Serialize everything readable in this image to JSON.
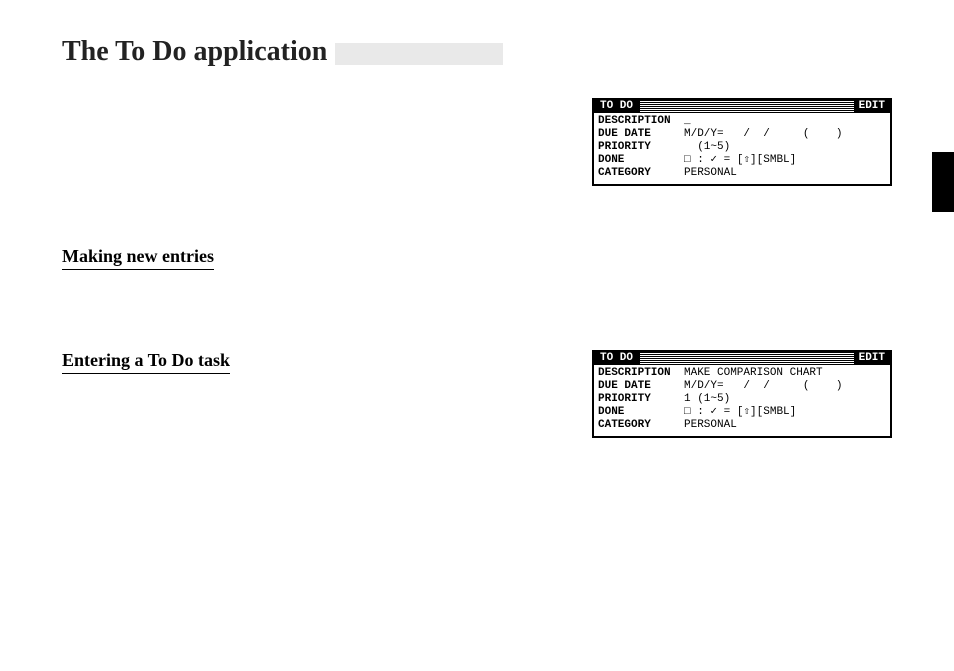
{
  "heading": "The To Do application",
  "section1_title": "Making new entries",
  "section2_title": "Entering a To Do task",
  "lcd1": {
    "tab": "TO DO",
    "mode": "EDIT",
    "rows": {
      "desc_label": "DESCRIPTION",
      "desc_value": "_",
      "due_label": "DUE DATE",
      "due_value": "M/D/Y=   /  /     (    )",
      "prio_label": "PRIORITY",
      "prio_value": "  (1~5)",
      "done_label": "DONE",
      "done_value": "□ : ✓ = [⇧][SMBL]",
      "cat_label": "CATEGORY",
      "cat_value": "PERSONAL"
    }
  },
  "lcd2": {
    "tab": "TO DO",
    "mode": "EDIT",
    "rows": {
      "desc_label": "DESCRIPTION",
      "desc_value": "MAKE COMPARISON CHART",
      "due_label": "DUE DATE",
      "due_value": "M/D/Y=   /  /     (    )",
      "prio_label": "PRIORITY",
      "prio_value": "1 (1~5)",
      "done_label": "DONE",
      "done_value": "□ : ✓ = [⇧][SMBL]",
      "cat_label": "CATEGORY",
      "cat_value": "PERSONAL"
    }
  }
}
